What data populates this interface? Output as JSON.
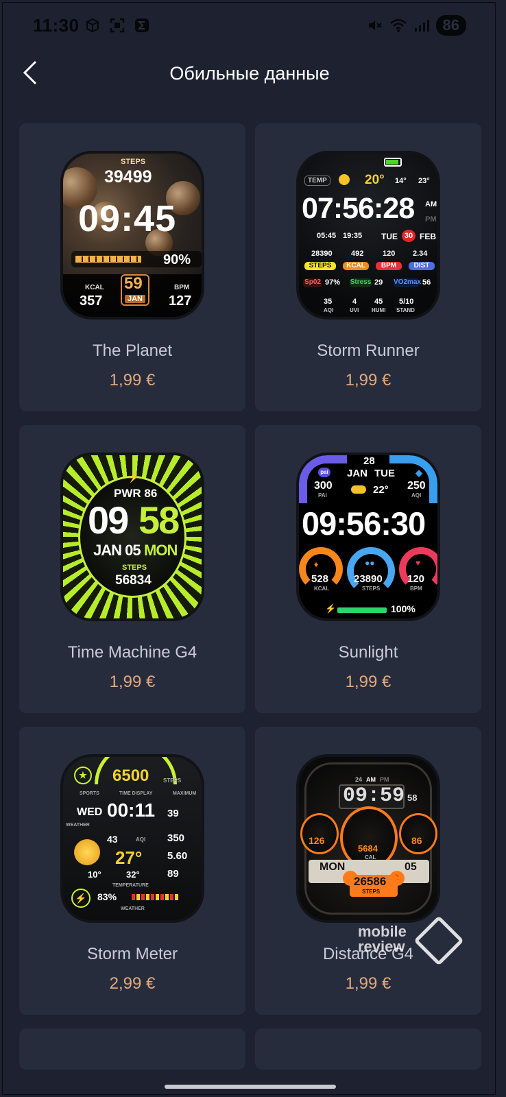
{
  "status_bar": {
    "time": "11:30",
    "battery": "86",
    "left_icons": [
      "cube-icon",
      "scan-icon",
      "sigma-icon"
    ],
    "right_icons": [
      "mute-icon",
      "wifi-icon",
      "signal-icon"
    ]
  },
  "header": {
    "title": "Обильные данные",
    "back_icon": "chevron-left-icon"
  },
  "colors": {
    "background": "#1d2130",
    "card": "#272c3d",
    "price": "#e2a97a",
    "name": "#c9ccd6"
  },
  "cards": [
    {
      "name": "The Planet",
      "price": "1,99 €",
      "face": {
        "steps_label": "STEPS",
        "steps": "39499",
        "time": "09:45",
        "battery": "90%",
        "kcal_label": "KCAL",
        "kcal": "357",
        "day": "59",
        "month": "JAN",
        "bpm_label": "BPM",
        "bpm": "127"
      }
    },
    {
      "name": "Storm Runner",
      "price": "1,99 €",
      "face": {
        "temp_label": "TEMP",
        "temp": "20°",
        "low": "14°",
        "high": "23°",
        "time": "07:56:28",
        "am": "AM",
        "pm": "PM",
        "sunrise": "05:45",
        "sunset": "19:35",
        "weekday": "TUE",
        "date": "30",
        "month": "FEB",
        "steps": "28390",
        "steps_label": "STEPS",
        "kcal": "492",
        "kcal_label": "KCAL",
        "bpm": "120",
        "bpm_label": "BPM",
        "dist": "2.34",
        "dist_label": "DIST",
        "spo2_label": "Sp02",
        "spo2": "97%",
        "stress_label": "Stress",
        "stress": "29",
        "vo2_label": "VO2max",
        "vo2": "56",
        "aqi": "35",
        "aqi_label": "AQI",
        "uvi": "4",
        "uvi_label": "UVI",
        "humi": "45",
        "humi_label": "HUMI",
        "stand": "5/10",
        "stand_label": "STAND"
      }
    },
    {
      "name": "Time Machine G4",
      "price": "1,99 €",
      "face": {
        "pwr": "PWR 86",
        "hour": "09",
        "minute": "58",
        "date": "JAN 05",
        "weekday": "MON",
        "steps_label": "STEPS",
        "steps": "56834"
      }
    },
    {
      "name": "Sunlight",
      "price": "1,99 €",
      "face": {
        "day": "28",
        "month": "JAN",
        "weekday": "TUE",
        "pai_badge": "pai",
        "pai": "300",
        "pai_label": "PAI",
        "temp": "22°",
        "aqi": "250",
        "aqi_label": "AQI",
        "time": "09:56:30",
        "kcal": "528",
        "kcal_label": "KCAL",
        "steps": "23890",
        "steps_label": "STEPS",
        "bpm": "120",
        "bpm_label": "BPM",
        "battery": "100%"
      }
    },
    {
      "name": "Storm Meter",
      "price": "2,99 €",
      "face": {
        "steps": "6500",
        "steps_label": "STEPS",
        "sports": "SPORTS",
        "time_display": "TIME DISPLAY",
        "maximum": "MAXIMUM",
        "weekday": "WED",
        "time": "00:11",
        "seconds": "39",
        "weather_label": "WEATHER",
        "rain": "43",
        "aqi_label": "AQI",
        "temp": "27°",
        "low": "10°",
        "high": "32°",
        "kcal": "350",
        "dist": "5.60",
        "bpm": "89",
        "temperature_label": "TEMPERATURE",
        "battery": "83%",
        "weather_bottom": "WEATHER"
      }
    },
    {
      "name": "Distance G4",
      "price": "1,99 €",
      "face": {
        "hour_label": "24",
        "am": "AM",
        "pm": "PM",
        "time": "09:59",
        "seconds": "58",
        "left_val": "126",
        "center_val": "5684",
        "center_label": "CAL",
        "right_val": "86",
        "weekday": "MON",
        "date": "05",
        "steps": "26586",
        "steps_label": "STEPS"
      }
    }
  ],
  "watermark": {
    "line1": "mobile",
    "line2": "review"
  }
}
